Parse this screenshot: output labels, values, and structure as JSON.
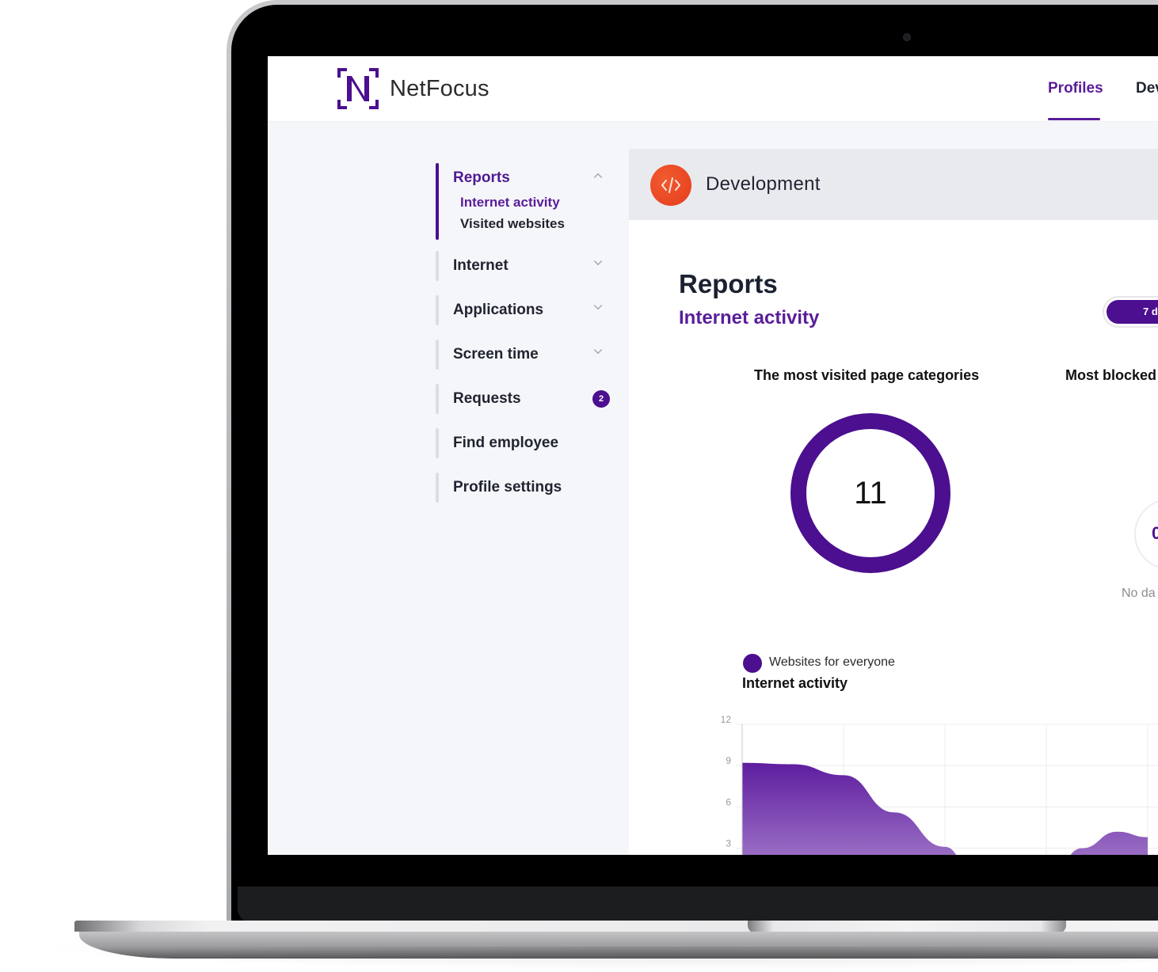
{
  "app": {
    "brand": "NetFocus",
    "accent_color": "#4b0f8f",
    "profile_color": "#e8441f"
  },
  "topnav": {
    "tabs": [
      {
        "label": "Profiles",
        "active": true
      },
      {
        "label": "Dev",
        "active": false
      }
    ]
  },
  "sidebar": {
    "groups": [
      {
        "label": "Reports",
        "expanded": true,
        "active": true,
        "children": [
          {
            "label": "Internet activity",
            "active": true
          },
          {
            "label": "Visited websites",
            "active": false
          }
        ]
      },
      {
        "label": "Internet",
        "expandable": true
      },
      {
        "label": "Applications",
        "expandable": true
      },
      {
        "label": "Screen time",
        "expandable": true
      },
      {
        "label": "Requests",
        "badge": "2"
      },
      {
        "label": "Find employee"
      },
      {
        "label": "Profile settings"
      }
    ]
  },
  "profile": {
    "name": "Development",
    "icon": "code-icon"
  },
  "page": {
    "title": "Reports",
    "subtitle": "Internet activity",
    "period_label": "7 d"
  },
  "cards": {
    "categories": {
      "title": "The most visited page categories",
      "total": "11",
      "legend": [
        {
          "label": "Websites for everyone",
          "color": "#4b0f8f"
        }
      ]
    },
    "blocked": {
      "title": "Most blocked",
      "value": "0",
      "empty_text": "No da"
    }
  },
  "chart_data": {
    "type": "area",
    "title": "Internet activity",
    "xlabel": "",
    "ylabel": "",
    "ylim": [
      0,
      12
    ],
    "yticks": [
      12,
      9,
      6,
      3
    ],
    "grid": true,
    "x": [
      0,
      0.5,
      1,
      1.5,
      2,
      2.3,
      2.7,
      3,
      3.35,
      3.7,
      4
    ],
    "values": [
      9.2,
      9.1,
      8.3,
      5.6,
      3.1,
      0.8,
      0,
      0.3,
      3.0,
      4.2,
      3.8
    ],
    "fill_color_top": "#5e1d9f",
    "fill_color_bottom": "#c3a6de"
  }
}
